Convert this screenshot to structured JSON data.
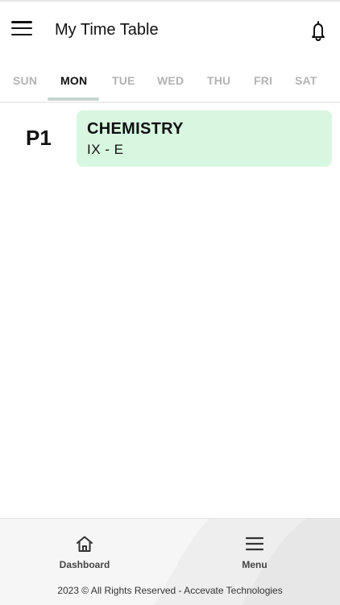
{
  "header": {
    "title": "My Time Table",
    "menu_icon": "hamburger-icon",
    "notification_icon": "bell-icon"
  },
  "tabs": [
    {
      "label": "SUN",
      "active": false
    },
    {
      "label": "MON",
      "active": true
    },
    {
      "label": "TUE",
      "active": false
    },
    {
      "label": "WED",
      "active": false
    },
    {
      "label": "THU",
      "active": false
    },
    {
      "label": "FRI",
      "active": false
    },
    {
      "label": "SAT",
      "active": false
    }
  ],
  "schedule": [
    {
      "period": "P1",
      "subject": "CHEMISTRY",
      "class": "IX - E",
      "color": "#d8f7e0"
    }
  ],
  "bottom_nav": {
    "dashboard_label": "Dashboard",
    "dashboard_icon": "home-icon",
    "menu_label": "Menu",
    "menu_icon": "hamburger-icon"
  },
  "footer": {
    "copyright": "2023 © All Rights Reserved - Accevate Technologies"
  }
}
